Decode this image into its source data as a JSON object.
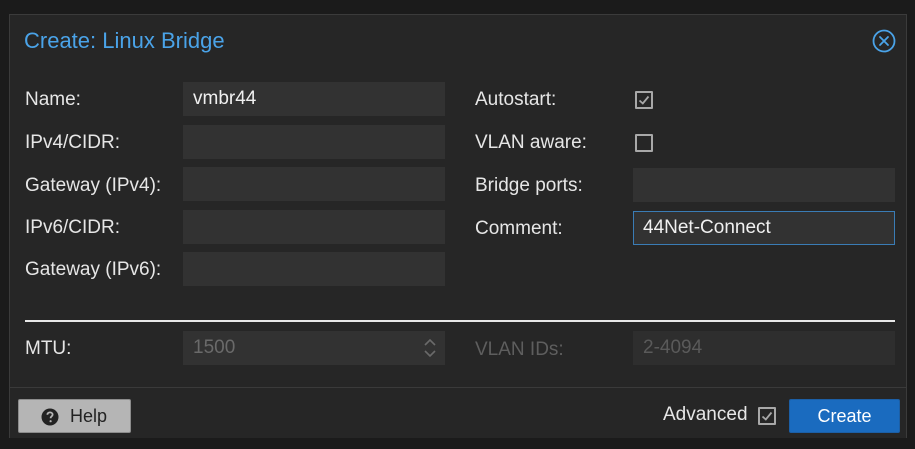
{
  "dialog": {
    "title": "Create: Linux Bridge",
    "close_icon": "close-circle-icon"
  },
  "form": {
    "name": {
      "label": "Name:",
      "value": "vmbr44"
    },
    "ipv4": {
      "label": "IPv4/CIDR:",
      "value": ""
    },
    "gateway_ipv4": {
      "label": "Gateway (IPv4):",
      "value": ""
    },
    "ipv6": {
      "label": "IPv6/CIDR:",
      "value": ""
    },
    "gateway_ipv6": {
      "label": "Gateway (IPv6):",
      "value": ""
    },
    "autostart": {
      "label": "Autostart:",
      "checked": true
    },
    "vlan_aware": {
      "label": "VLAN aware:",
      "checked": false
    },
    "bridge_ports": {
      "label": "Bridge ports:",
      "value": ""
    },
    "comment": {
      "label": "Comment:",
      "value": "44Net-Connect"
    }
  },
  "advanced": {
    "mtu": {
      "label": "MTU:",
      "placeholder": "1500"
    },
    "vlan_ids": {
      "label": "VLAN IDs:",
      "placeholder": "2-4094"
    }
  },
  "footer": {
    "help_label": "Help",
    "help_icon": "question-circle-icon",
    "advanced_label": "Advanced",
    "advanced_checked": true,
    "create_label": "Create"
  },
  "colors": {
    "accent": "#4aa3e8",
    "primary_button": "#1a6bbf",
    "dialog_bg": "#262626",
    "field_bg": "#323232"
  }
}
